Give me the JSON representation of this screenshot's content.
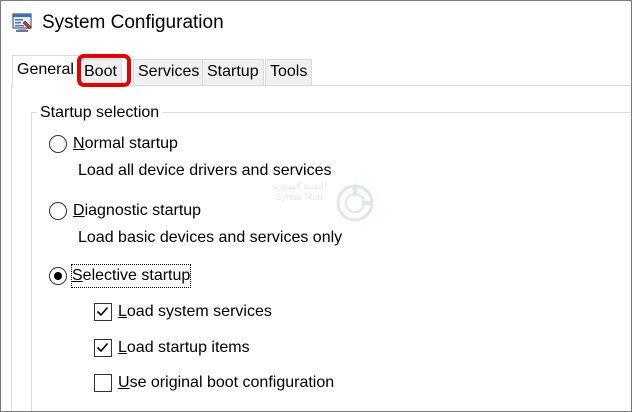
{
  "window": {
    "title": "System Configuration",
    "icon": "msconfig-icon"
  },
  "tabs": [
    {
      "label": "General",
      "active": true
    },
    {
      "label": "Boot",
      "active": false,
      "highlighted": true
    },
    {
      "label": "Services",
      "active": false
    },
    {
      "label": "Startup",
      "active": false
    },
    {
      "label": "Tools",
      "active": false
    }
  ],
  "startup_selection": {
    "group_label": "Startup selection",
    "options": [
      {
        "id": "normal",
        "label_access": "N",
        "label_rest": "ormal startup",
        "description": "Load all device drivers and services",
        "selected": false
      },
      {
        "id": "diagnostic",
        "label_access": "D",
        "label_rest": "iagnostic startup",
        "description": "Load basic devices and services only",
        "selected": false
      },
      {
        "id": "selective",
        "label_access": "S",
        "label_rest": "elective startup",
        "selected": true
      }
    ],
    "checkboxes": [
      {
        "label_access": "L",
        "label_rest": "oad system services",
        "checked": true
      },
      {
        "label_access": "L",
        "label_rest": "oad startup items",
        "checked": true
      },
      {
        "label_access": "U",
        "label_rest": "se original boot configuration",
        "checked": false
      }
    ]
  },
  "watermark": {
    "line1": "التقنية السورية",
    "line2": "Syrian Tech"
  },
  "colors": {
    "highlight": "#e60000",
    "tab_inactive": "#f0f0f0",
    "border": "#d9d9d9"
  }
}
